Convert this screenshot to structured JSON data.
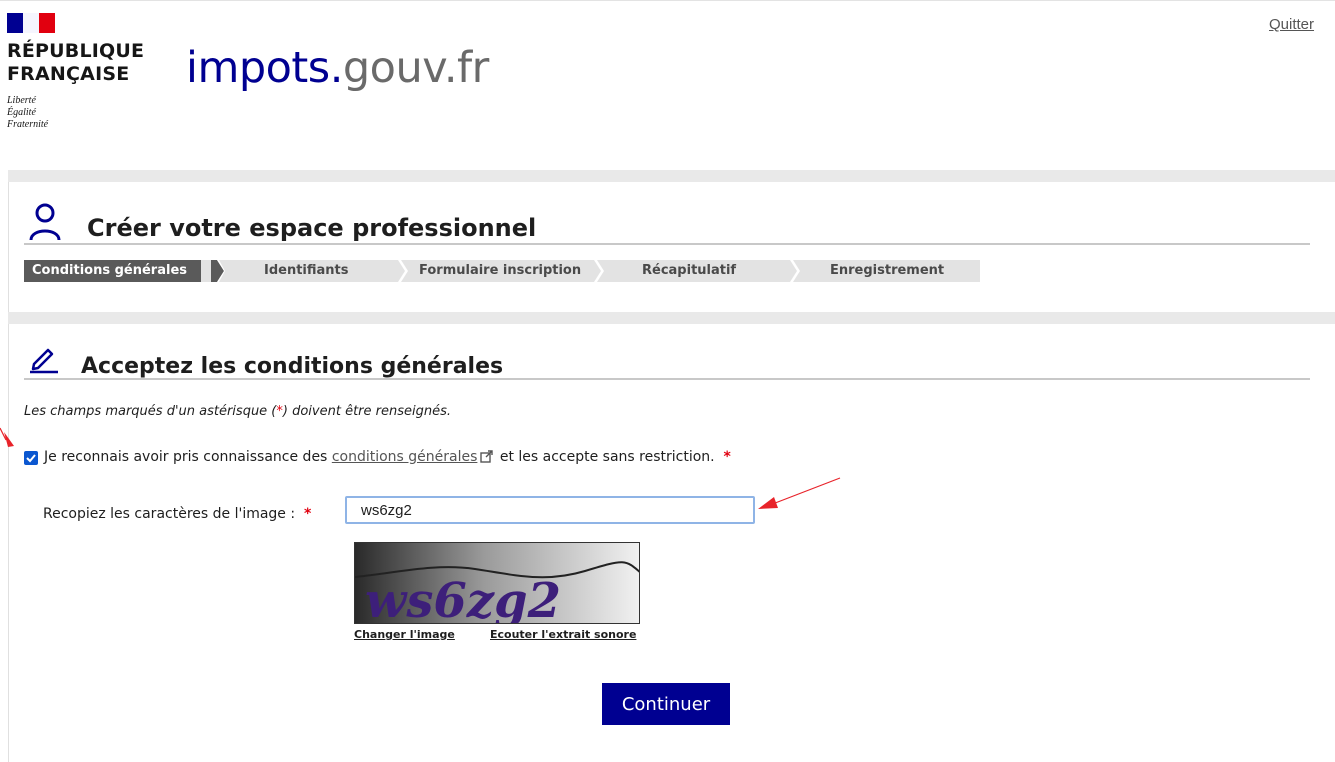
{
  "header": {
    "republic_line1": "RÉPUBLIQUE",
    "republic_line2": "FRANÇAISE",
    "motto": [
      "Liberté",
      "Égalité",
      "Fraternité"
    ],
    "brand_main": "impots.",
    "brand_tld": "gouv.fr",
    "quit_label": "Quitter"
  },
  "section1": {
    "title": "Créer votre espace professionnel",
    "steps": [
      {
        "label": "Conditions générales",
        "active": true
      },
      {
        "label": "Identifiants",
        "active": false
      },
      {
        "label": "Formulaire inscription",
        "active": false
      },
      {
        "label": "Récapitulatif",
        "active": false
      },
      {
        "label": "Enregistrement",
        "active": false
      }
    ]
  },
  "section2": {
    "title": "Acceptez les conditions générales",
    "note_before": "Les champs marqués d'un astérisque (",
    "note_star": "*",
    "note_after": ") doivent être renseignés.",
    "checkbox_checked": true,
    "checkbox_text_before": "Je reconnais avoir pris connaissance des ",
    "checkbox_link": "conditions générales",
    "checkbox_text_after": " et les accepte sans restriction.",
    "required_star": "*",
    "captcha_label": "Recopiez les caractères de l'image :",
    "captcha_value": "ws6zg2",
    "captcha_image_text": "ws6zg2",
    "change_image": "Changer l'image",
    "audio_link": "Ecouter l'extrait sonore",
    "continue_label": "Continuer"
  },
  "colors": {
    "brand_blue": "#000091",
    "marianne_red": "#e1000f",
    "active_step": "#5a5a5a",
    "annotation_arrow": "#e8232a"
  }
}
